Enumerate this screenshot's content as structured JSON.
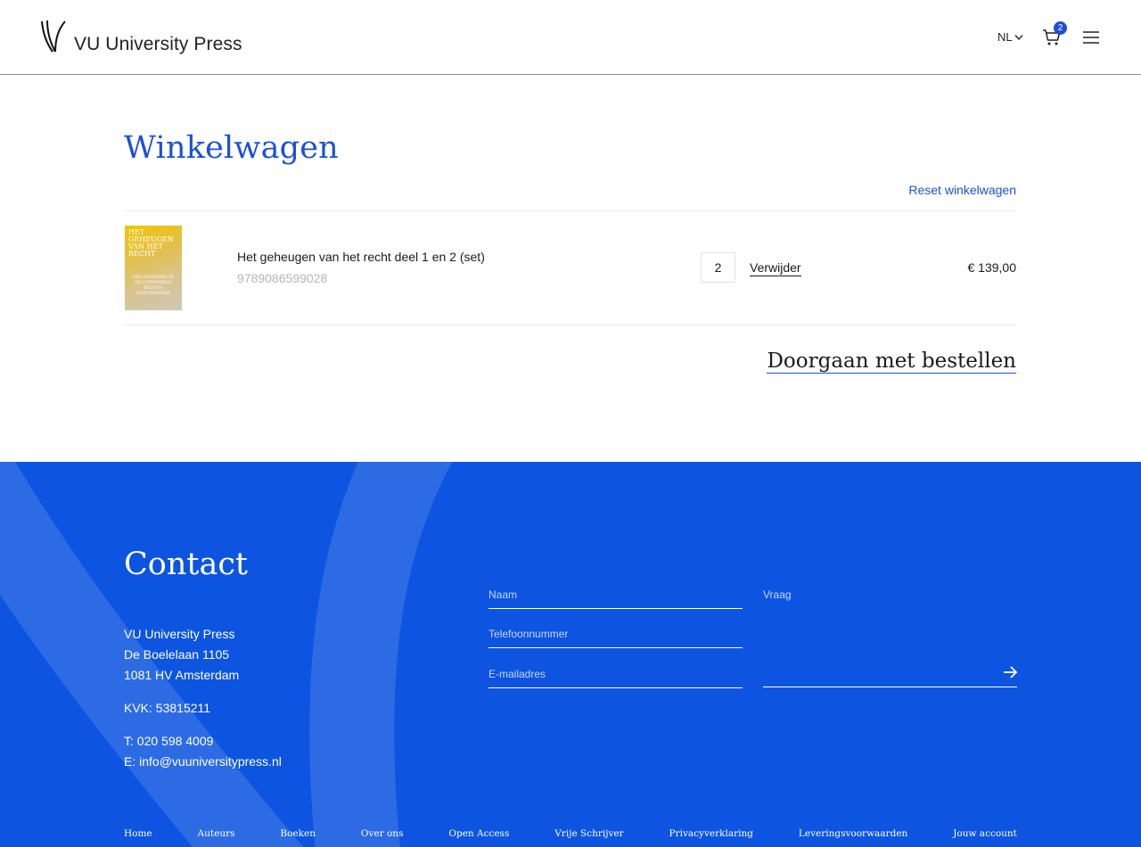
{
  "header": {
    "logo_text": "VU University Press",
    "language": "NL",
    "cart_count": "2"
  },
  "cart": {
    "title": "Winkelwagen",
    "reset_label": "Reset winkelwagen",
    "items": [
      {
        "title": "Het geheugen van het recht deel 1 en 2 (set)",
        "isbn": "9789086599028",
        "quantity": "2",
        "remove_label": "Verwijder",
        "price": "€ 139,00",
        "cover": {
          "title": "HET GEHEUGEN VAN HET RECHT",
          "subtitle": "EEN INLEIDING IN DE UITWENDIGE RECHTS-GESCHIEDENIS"
        }
      }
    ],
    "proceed_label": "Doorgaan met bestellen"
  },
  "contact": {
    "title": "Contact",
    "address_lines": [
      "VU University Press",
      "De Boelelaan 1105",
      "1081 HV Amsterdam"
    ],
    "kvk": "KVK: 53815211",
    "phone": "T: 020 598 4009",
    "email": "E: info@vuuniversitypress.nl",
    "form": {
      "name_placeholder": "Naam",
      "phone_placeholder": "Telefoonnummer",
      "email_placeholder": "E-mailadres",
      "question_placeholder": "Vraag"
    }
  },
  "footer_nav": [
    "Home",
    "Auteurs",
    "Boeken",
    "Over ons",
    "Open Access",
    "Vrije Schrijver",
    "Privacyverklaring",
    "Leveringsvoorwaarden",
    "Jouw account"
  ],
  "colors": {
    "accent": "#1d50d8",
    "footer_bg": "#0d55e0"
  }
}
